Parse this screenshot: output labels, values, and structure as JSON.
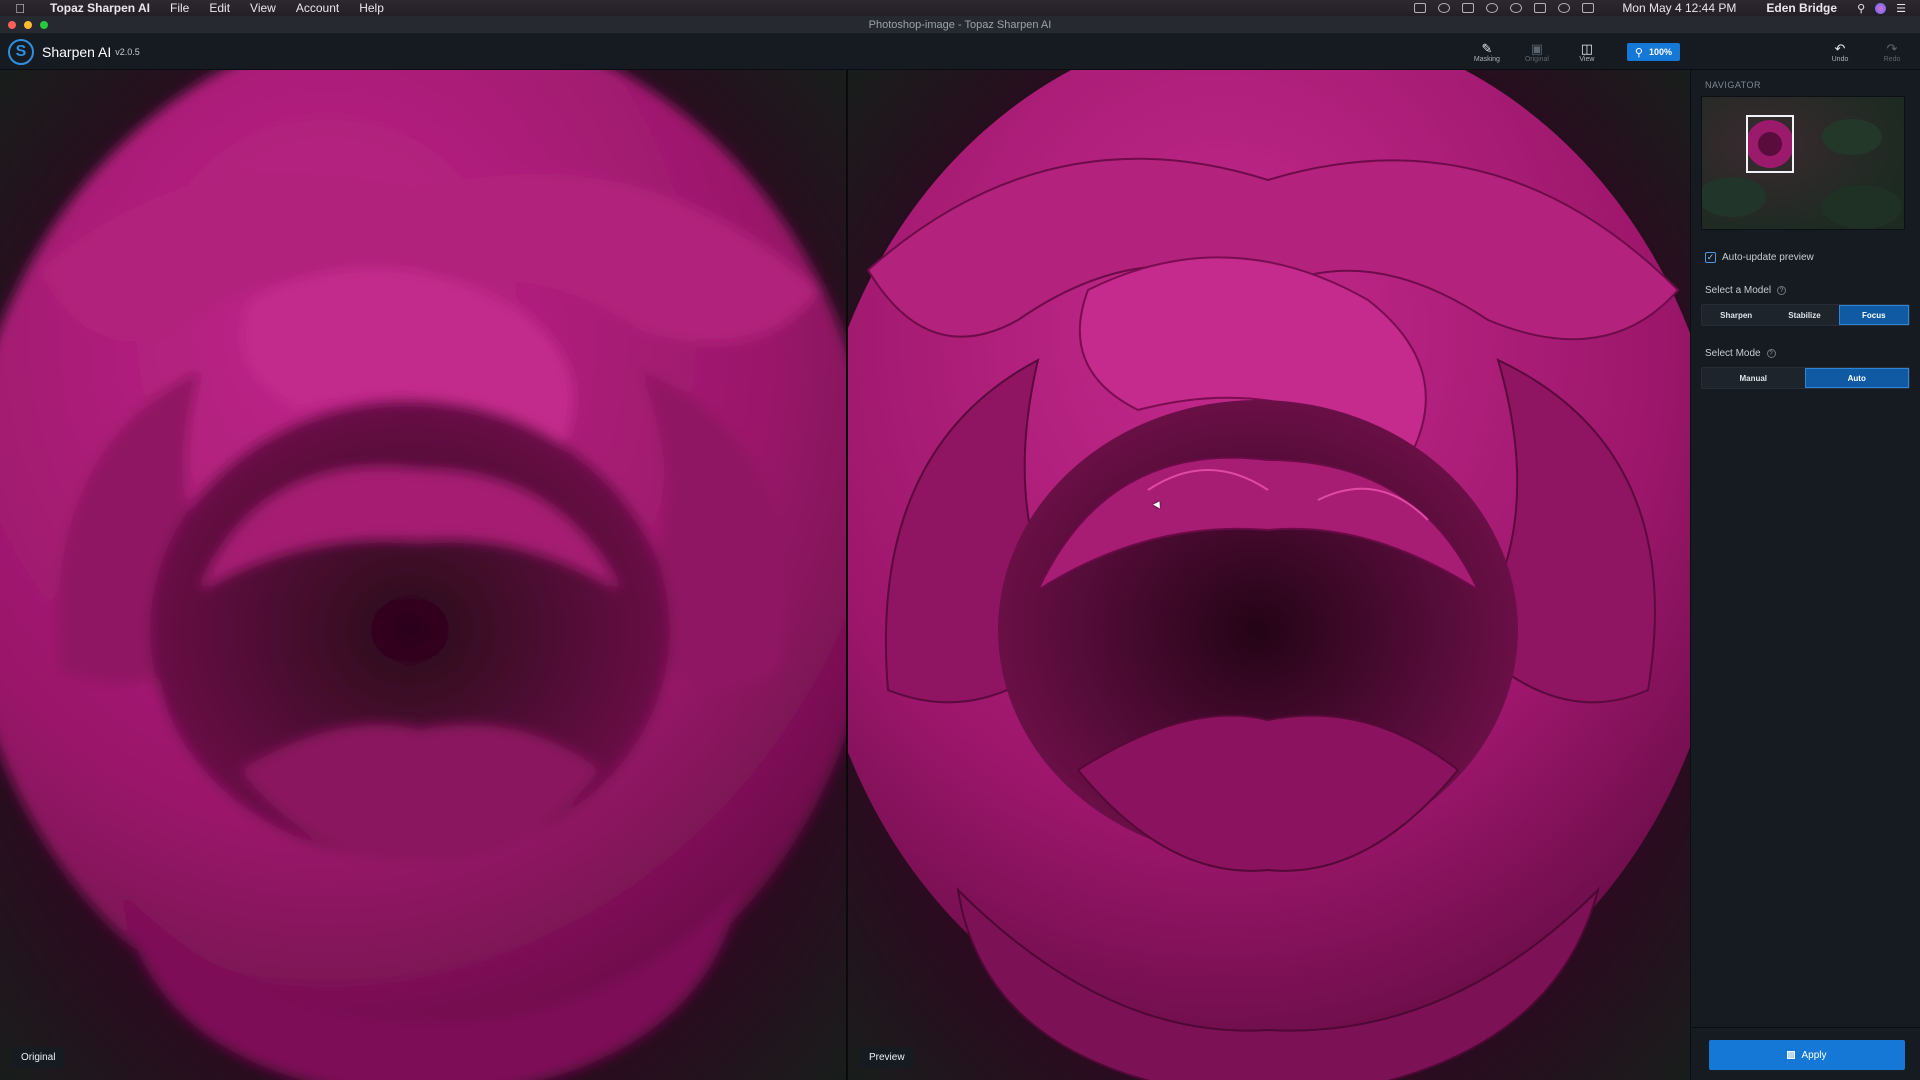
{
  "menubar": {
    "app": "Topaz Sharpen AI",
    "items": [
      "File",
      "Edit",
      "View",
      "Account",
      "Help"
    ],
    "clock": "Mon May 4  12:44 PM",
    "user": "Eden Bridge"
  },
  "window": {
    "title": "Photoshop-image - Topaz Sharpen AI"
  },
  "app": {
    "name": "Sharpen AI",
    "version": "v2.0.5"
  },
  "toolbar": {
    "masking": "Masking",
    "original": "Original",
    "view": "View",
    "zoom": "100%",
    "undo": "Undo",
    "redo": "Redo"
  },
  "canvas": {
    "left_label": "Original",
    "right_label": "Preview"
  },
  "panel": {
    "navigator": "NAVIGATOR",
    "auto_update": "Auto-update preview",
    "model_label": "Select a Model",
    "models": [
      "Sharpen",
      "Stabilize",
      "Focus"
    ],
    "active_model": "Focus",
    "mode_label": "Select Mode",
    "modes": [
      "Manual",
      "Auto"
    ],
    "active_mode": "Auto",
    "apply": "Apply"
  },
  "colors": {
    "accent": "#1577d6",
    "petal": "#a81a74",
    "petal_dark": "#3d0a2a"
  }
}
